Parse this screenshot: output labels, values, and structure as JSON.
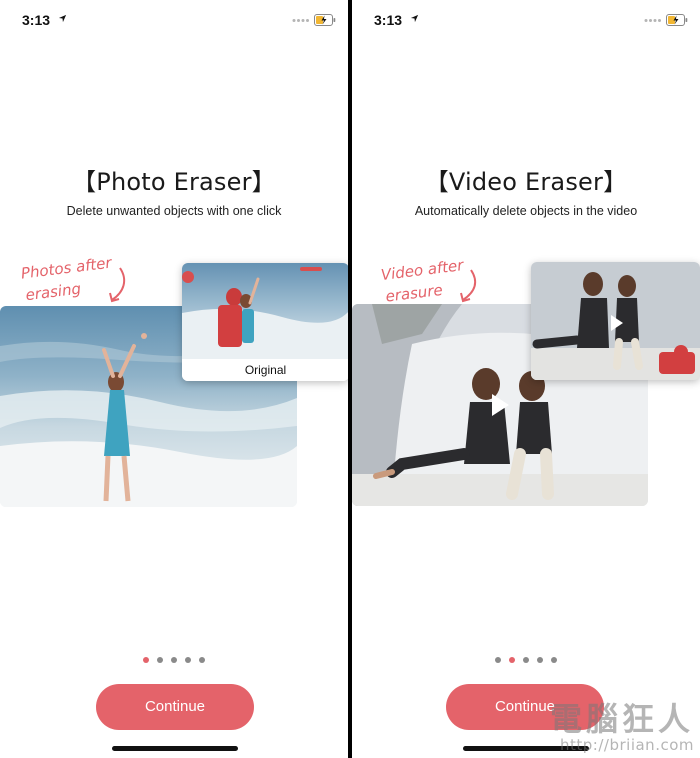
{
  "screens": [
    {
      "status": {
        "time": "3:13"
      },
      "title": "【Photo Eraser】",
      "subtitle": "Delete unwanted objects with one click",
      "annotation": {
        "line1": "Photos after",
        "line2": "erasing"
      },
      "comparison_caption": "Original",
      "pager": {
        "total": 5,
        "active": 1
      },
      "continue_label": "Continue"
    },
    {
      "status": {
        "time": "3:13"
      },
      "title": "【Video Eraser】",
      "subtitle": "Automatically delete objects in the video",
      "annotation": {
        "line1": "Video after",
        "line2": "erasure"
      },
      "pager": {
        "total": 5,
        "active": 2
      },
      "continue_label": "Continue"
    }
  ],
  "watermark": {
    "brand": "電腦狂人",
    "url": "http://briian.com"
  },
  "colors": {
    "accent": "#e4636a",
    "dot_inactive": "#8a8a8a",
    "background": "#ffffff"
  }
}
